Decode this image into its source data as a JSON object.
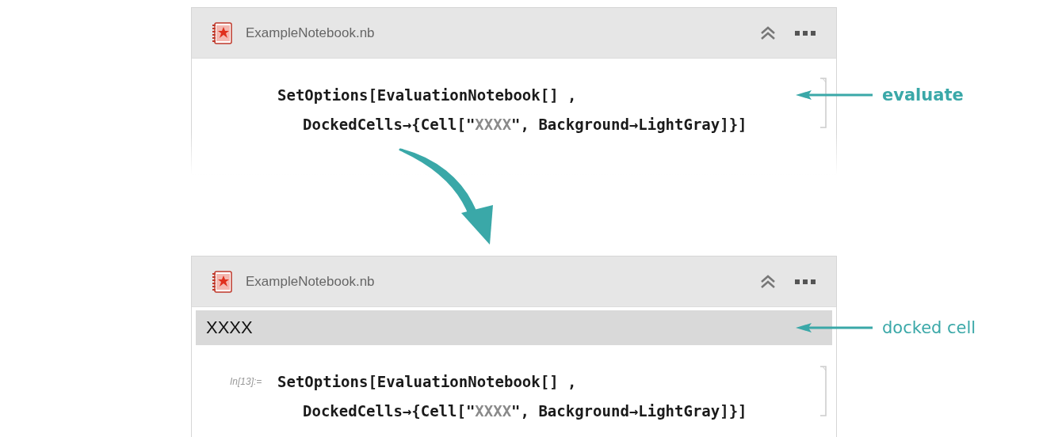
{
  "notebooks": [
    {
      "title": "ExampleNotebook.nb",
      "code_lines": [
        [
          {
            "kind": "plain",
            "text": "SetOptions[EvaluationNotebook[] ,"
          }
        ],
        [
          {
            "kind": "plain",
            "text": "DockedCells→{Cell[\""
          },
          {
            "kind": "string",
            "text": "XXXX"
          },
          {
            "kind": "plain",
            "text": "\", Background→LightGray]}]"
          }
        ]
      ],
      "callout": {
        "kind": "input",
        "text": "evaluate"
      }
    },
    {
      "title": "ExampleNotebook.nb",
      "docked_cell": "XXXX",
      "input_label": "In[13]:=",
      "code_lines": [
        [
          {
            "kind": "plain",
            "text": "SetOptions[EvaluationNotebook[] ,"
          }
        ],
        [
          {
            "kind": "plain",
            "text": "DockedCells→{Cell[\""
          },
          {
            "kind": "string",
            "text": "XXXX"
          },
          {
            "kind": "plain",
            "text": "\", Background→LightGray]}]"
          }
        ]
      ],
      "callout": {
        "kind": "docked",
        "text": "docked cell"
      }
    }
  ]
}
